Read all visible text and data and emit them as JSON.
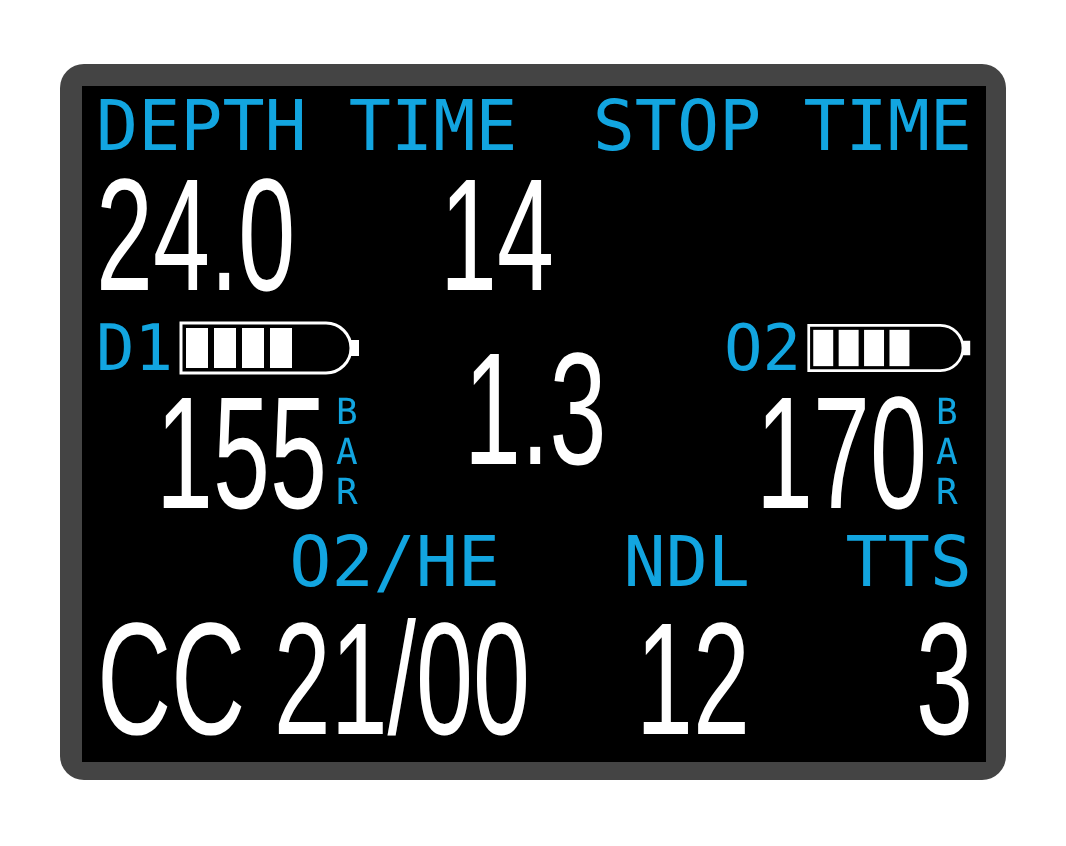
{
  "header_labels": [
    "DEPTH TIME",
    "STOP TIME"
  ],
  "depth": "24.0",
  "time": "14",
  "cylinders": [
    {
      "label": "D1",
      "pressure": "155",
      "unit": "BAR"
    },
    {
      "label": "O2",
      "pressure": "170",
      "unit": "BAR"
    }
  ],
  "ppo2": "1.3",
  "bottom_labels": [
    "O2/HE",
    "NDL",
    "TTS"
  ],
  "bottom_values": [
    "CC 21/00",
    "12",
    "3"
  ]
}
